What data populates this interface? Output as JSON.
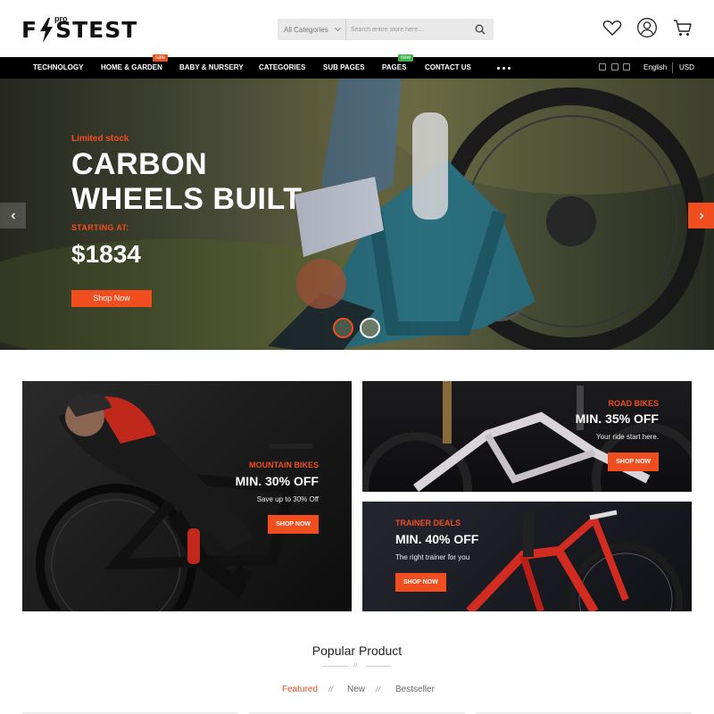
{
  "brand": {
    "name": "F STEST",
    "super": "pro"
  },
  "search": {
    "category": "All Categories",
    "placeholder": "Search entire store here..."
  },
  "header_icons": [
    "heart-icon",
    "user-icon",
    "cart-icon"
  ],
  "nav": {
    "items": [
      {
        "label": "TECHNOLOGY"
      },
      {
        "label": "HOME & GARDEN",
        "badge": "sale",
        "badge_color": "#f04e1f"
      },
      {
        "label": "BABY & NURSERY"
      },
      {
        "label": "CATEGORIES"
      },
      {
        "label": "SUB PAGES"
      },
      {
        "label": "PAGES",
        "badge": "new",
        "badge_color": "#39b54a"
      },
      {
        "label": "CONTACT US"
      }
    ],
    "social": [
      "twitter-icon",
      "facebook-icon",
      "linkedin-icon"
    ],
    "language": "English",
    "currency": "USD"
  },
  "hero": {
    "tag": "Limited stock",
    "title_line1": "CARBON",
    "title_line2": "WHEELS BUILT",
    "starting": "STARTING AT:",
    "price": "$1834",
    "button": "Shop Now",
    "accent": "#f04e1f"
  },
  "banners": {
    "mountain": {
      "sub": "MOUNTAIN BIKES",
      "title": "MIN. 30% OFF",
      "text": "Save up to 30% Off",
      "button": "SHOP NOW"
    },
    "road": {
      "sub": "ROAD BIKES",
      "title": "MIN. 35% OFF",
      "text": "Your ride start here.",
      "button": "SHOP NOW"
    },
    "trainer": {
      "sub": "TRAINER DEALS",
      "title": "MIN. 40% OFF",
      "text": "The right trainer for you",
      "button": "SHOP NOW"
    }
  },
  "popular": {
    "title": "Popular Product",
    "separator": "//",
    "tabs": [
      {
        "label": "Featured",
        "active": true
      },
      {
        "label": "New"
      },
      {
        "label": "Bestseller"
      }
    ]
  }
}
